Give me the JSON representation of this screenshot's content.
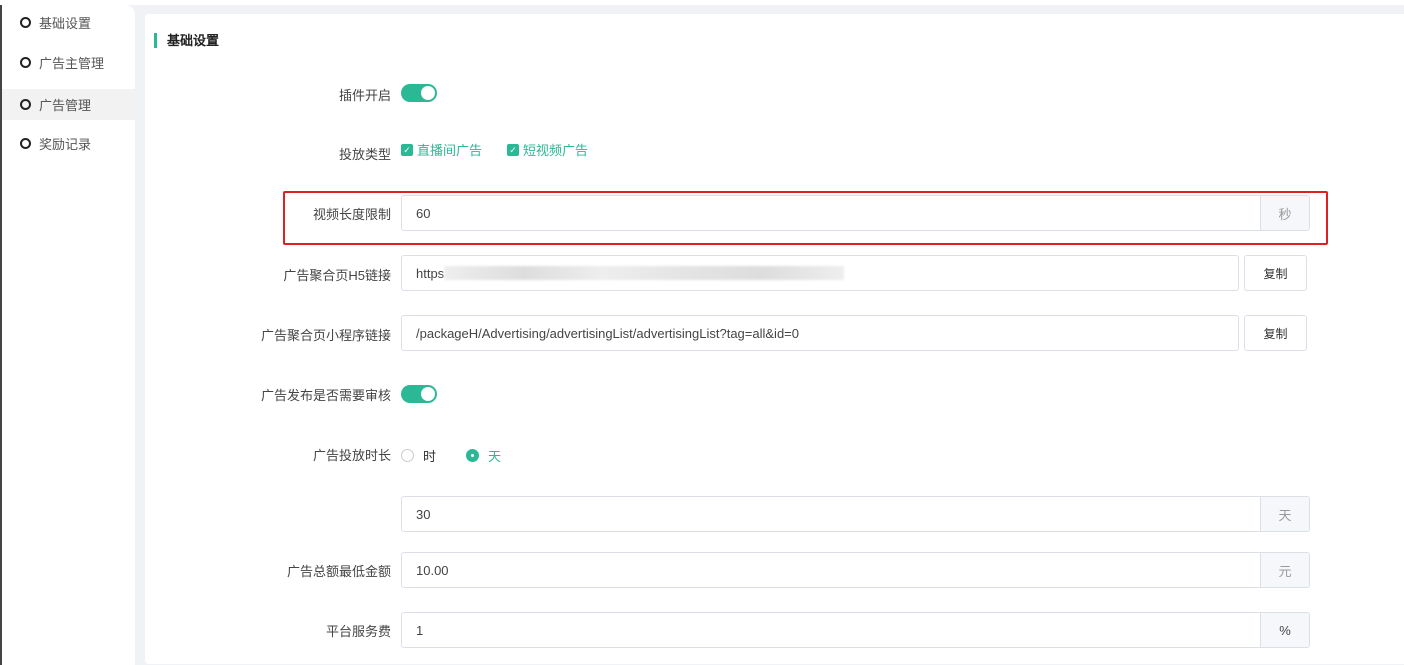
{
  "sidebar": {
    "items": [
      {
        "label": "基础设置"
      },
      {
        "label": "广告主管理"
      },
      {
        "label": "广告管理"
      },
      {
        "label": "奖励记录"
      }
    ]
  },
  "section_title": "基础设置",
  "form": {
    "plugin_enabled": {
      "label": "插件开启",
      "on": true
    },
    "delivery_type": {
      "label": "投放类型",
      "options": [
        {
          "label": "直播间广告",
          "checked": true
        },
        {
          "label": "短视频广告",
          "checked": true
        }
      ]
    },
    "video_limit": {
      "label": "视频长度限制",
      "value": "60",
      "unit": "秒"
    },
    "h5_link": {
      "label": "广告聚合页H5链接",
      "value": "https",
      "copy": "复制"
    },
    "mini_link": {
      "label": "广告聚合页小程序链接",
      "value": "/packageH/Advertising/advertisingList/advertisingList?tag=all&id=0",
      "copy": "复制"
    },
    "review": {
      "label": "广告发布是否需要审核",
      "on": true
    },
    "duration": {
      "label": "广告投放时长",
      "options": [
        "时",
        "天"
      ],
      "selected": "天",
      "value": "30",
      "unit": "天"
    },
    "min_amount": {
      "label": "广告总额最低金额",
      "value": "10.00",
      "unit": "元"
    },
    "service_fee": {
      "label": "平台服务费",
      "value": "1",
      "unit": "%"
    }
  }
}
